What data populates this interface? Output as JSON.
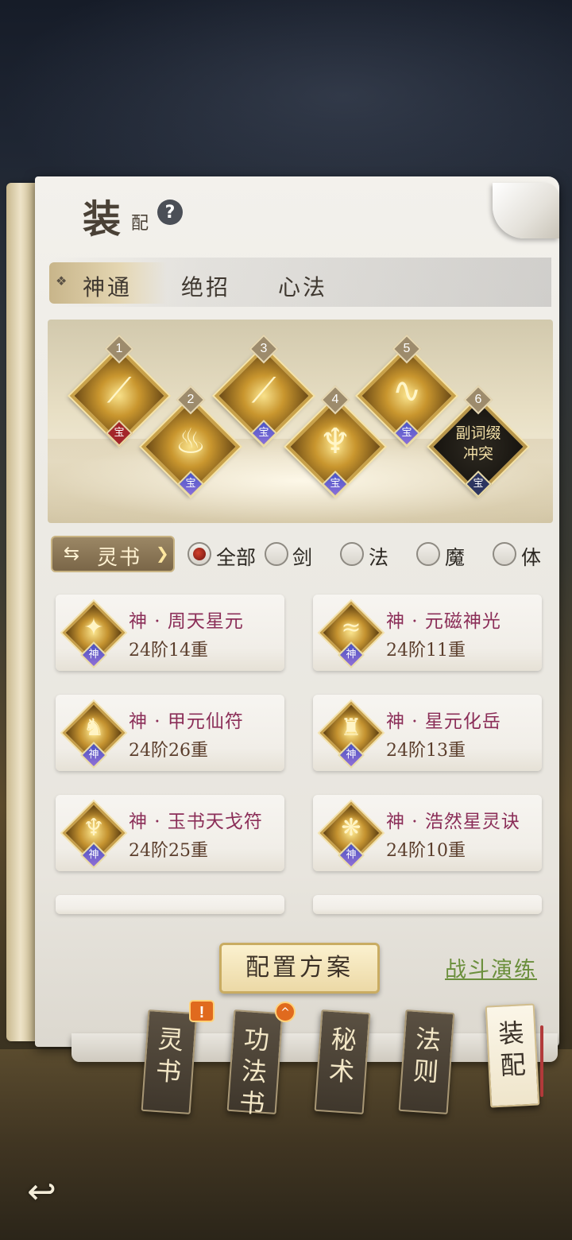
{
  "header": {
    "title_big": "装",
    "title_small": "配",
    "help_icon": "?"
  },
  "tabs": [
    {
      "label": "神通",
      "active": true
    },
    {
      "label": "绝招",
      "active": false
    },
    {
      "label": "心法",
      "active": false
    }
  ],
  "slots": [
    {
      "num": "1",
      "badge": "宝",
      "badge_color": "#a3262a",
      "icon": "slash-icon"
    },
    {
      "num": "2",
      "badge": "宝",
      "badge_color": "#4a56c8",
      "icon": "flame-icon"
    },
    {
      "num": "3",
      "badge": "宝",
      "badge_color": "#4a56c8",
      "icon": "slash-icon"
    },
    {
      "num": "4",
      "badge": "宝",
      "badge_color": "#4a56c8",
      "icon": "trident-icon"
    },
    {
      "num": "5",
      "badge": "宝",
      "badge_color": "#4a56c8",
      "icon": "swirl-icon"
    },
    {
      "num": "6",
      "badge": "宝",
      "badge_color": "#2c3560",
      "conflict_line1": "副词缀",
      "conflict_line2": "冲突"
    }
  ],
  "filter": {
    "book_label": "灵书",
    "options": [
      {
        "label": "全部",
        "checked": true
      },
      {
        "label": "剑",
        "checked": false
      },
      {
        "label": "法",
        "checked": false
      },
      {
        "label": "魔",
        "checked": false
      },
      {
        "label": "体",
        "checked": false
      }
    ]
  },
  "cards": [
    {
      "name": "神 · 周天星元",
      "level": "24阶14重",
      "badge": "神"
    },
    {
      "name": "神 · 元磁神光",
      "level": "24阶11重",
      "badge": "神"
    },
    {
      "name": "神 · 甲元仙符",
      "level": "24阶26重",
      "badge": "神"
    },
    {
      "name": "神 · 星元化岳",
      "level": "24阶13重",
      "badge": "神"
    },
    {
      "name": "神 · 玉书天戈符",
      "level": "24阶25重",
      "badge": "神"
    },
    {
      "name": "神 · 浩然星灵诀",
      "level": "24阶10重",
      "badge": "神"
    }
  ],
  "actions": {
    "plan_button": "配置方案",
    "battle_link": "战斗演练"
  },
  "bookmarks": [
    {
      "line1": "灵",
      "line2": "书",
      "active": false,
      "alert": "!"
    },
    {
      "line1": "功法",
      "line2": "书",
      "active": false,
      "up": "^"
    },
    {
      "line1": "秘",
      "line2": "术",
      "active": false
    },
    {
      "line1": "法",
      "line2": "则",
      "active": false
    },
    {
      "line1": "装",
      "line2": "配",
      "active": true
    }
  ],
  "colors": {
    "card_name": "#8b2e58",
    "battle_link": "#6b8f3c",
    "accent_gold": "#c9a24a"
  }
}
